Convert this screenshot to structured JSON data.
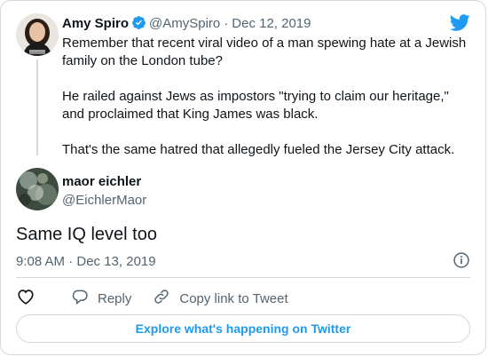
{
  "quoted_tweet": {
    "author_name": "Amy Spiro",
    "author_handle": "@AmySpiro",
    "date": "Dec 12, 2019",
    "separator": "·",
    "verified_icon": "verified-badge-icon",
    "paragraphs": [
      "Remember that recent viral video of a man spewing hate at a Jewish family on the London tube?",
      "He railed against Jews as impostors \"trying to claim our heritage,\" and proclaimed that King James was black.",
      "That's the same hatred that allegedly fueled the Jersey City attack."
    ]
  },
  "main_tweet": {
    "author_name": "maor eichler",
    "author_handle": "@EichlerMaor",
    "text": "Same IQ level too",
    "timestamp": "9:08 AM · Dec 13, 2019"
  },
  "actions": {
    "like_icon": "heart-icon",
    "reply_label": "Reply",
    "copy_link_label": "Copy link to Tweet"
  },
  "explore_label": "Explore what's happening on Twitter",
  "colors": {
    "brand_blue": "#1d9bf0",
    "text": "#0f1419",
    "secondary": "#536471",
    "border": "#cfd9de"
  }
}
